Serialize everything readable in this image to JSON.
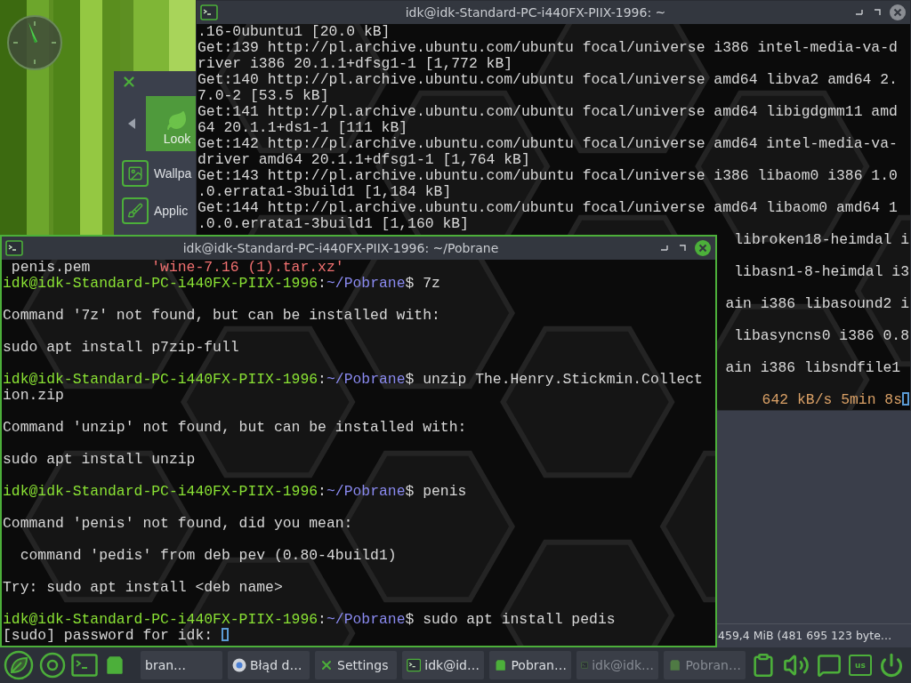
{
  "settings_window": {
    "items": [
      {
        "label": "Look",
        "selected": true
      },
      {
        "label": "Wallpa",
        "selected": false
      },
      {
        "label": "Applic",
        "selected": false
      }
    ]
  },
  "file_window": {
    "status": "459,4 MiB (481 695 123 byte…"
  },
  "terminals": [
    {
      "title": "idk@idk-Standard-PC-i440FX-PIIX-1996: ~",
      "active": false,
      "lines": [
        {
          "kind": "text",
          "segments": [
            {
              "kind": "plain",
              "text": ".16-0ubuntu1 [20.0 kB]"
            }
          ]
        },
        {
          "kind": "text",
          "segments": [
            {
              "kind": "plain",
              "text": "Get:139 http://pl.archive.ubuntu.com/ubuntu focal/universe i386 intel-media-va-d"
            }
          ]
        },
        {
          "kind": "text",
          "segments": [
            {
              "kind": "plain",
              "text": "river i386 20.1.1+dfsg1-1 [1,772 kB]"
            }
          ]
        },
        {
          "kind": "text",
          "segments": [
            {
              "kind": "plain",
              "text": "Get:140 http://pl.archive.ubuntu.com/ubuntu focal/universe amd64 libva2 amd64 2."
            }
          ]
        },
        {
          "kind": "text",
          "segments": [
            {
              "kind": "plain",
              "text": "7.0-2 [53.5 kB]"
            }
          ]
        },
        {
          "kind": "text",
          "segments": [
            {
              "kind": "plain",
              "text": "Get:141 http://pl.archive.ubuntu.com/ubuntu focal/universe amd64 libigdgmm11 amd"
            }
          ]
        },
        {
          "kind": "text",
          "segments": [
            {
              "kind": "plain",
              "text": "64 20.1.1+ds1-1 [111 kB]"
            }
          ]
        },
        {
          "kind": "text",
          "segments": [
            {
              "kind": "plain",
              "text": "Get:142 http://pl.archive.ubuntu.com/ubuntu focal/universe amd64 intel-media-va-"
            }
          ]
        },
        {
          "kind": "text",
          "segments": [
            {
              "kind": "plain",
              "text": "driver amd64 20.1.1+dfsg1-1 [1,764 kB]"
            }
          ]
        },
        {
          "kind": "text",
          "segments": [
            {
              "kind": "plain",
              "text": "Get:143 http://pl.archive.ubuntu.com/ubuntu focal/universe i386 libaom0 i386 1.0"
            }
          ]
        },
        {
          "kind": "text",
          "segments": [
            {
              "kind": "plain",
              "text": ".0.errata1-3build1 [1,184 kB]"
            }
          ]
        },
        {
          "kind": "text",
          "segments": [
            {
              "kind": "plain",
              "text": "Get:144 http://pl.archive.ubuntu.com/ubuntu focal/universe amd64 libaom0 amd64 1"
            }
          ]
        },
        {
          "kind": "text",
          "segments": [
            {
              "kind": "plain",
              "text": ".0.0.errata1-3build1 [1,160 kB]"
            }
          ]
        },
        {
          "kind": "tail",
          "segments": [
            {
              "kind": "plain",
              "text": "libroken18-heimdal i"
            }
          ]
        },
        {
          "kind": "blank"
        },
        {
          "kind": "tail",
          "segments": [
            {
              "kind": "plain",
              "text": "libasn1-8-heimdal i3"
            }
          ]
        },
        {
          "kind": "blank"
        },
        {
          "kind": "tail",
          "segments": [
            {
              "kind": "plain",
              "text": "ain i386 libasound2 i"
            }
          ]
        },
        {
          "kind": "blank"
        },
        {
          "kind": "tail",
          "segments": [
            {
              "kind": "plain",
              "text": "libasyncns0 i386 0.8"
            }
          ]
        },
        {
          "kind": "blank"
        },
        {
          "kind": "tail",
          "segments": [
            {
              "kind": "plain",
              "text": "ain i386 libsndfile1 "
            }
          ]
        },
        {
          "kind": "blank"
        },
        {
          "kind": "tail",
          "segments": [
            {
              "kind": "progress",
              "text": "642 kB/s 5min 8s"
            },
            {
              "kind": "cursor"
            }
          ]
        }
      ]
    },
    {
      "title": "idk@idk-Standard-PC-i440FX-PIIX-1996: ~/Pobrane",
      "active": true,
      "lines": [
        {
          "kind": "text",
          "segments": [
            {
              "kind": "plain",
              "text": " penis.pem       "
            },
            {
              "kind": "red",
              "text": "'wine-7.16 (1).tar.xz'"
            }
          ]
        },
        {
          "kind": "text",
          "segments": [
            {
              "kind": "user",
              "text": "idk@idk-Standard-PC-i440FX-PIIX-1996"
            },
            {
              "kind": "plain",
              "text": ":"
            },
            {
              "kind": "path",
              "text": "~/Pobrane"
            },
            {
              "kind": "plain",
              "text": "$ 7z"
            }
          ]
        },
        {
          "kind": "blank"
        },
        {
          "kind": "text",
          "segments": [
            {
              "kind": "plain",
              "text": "Command '7z' not found, but can be installed with:"
            }
          ]
        },
        {
          "kind": "blank"
        },
        {
          "kind": "text",
          "segments": [
            {
              "kind": "plain",
              "text": "sudo apt install p7zip-full"
            }
          ]
        },
        {
          "kind": "blank"
        },
        {
          "kind": "text",
          "segments": [
            {
              "kind": "user",
              "text": "idk@idk-Standard-PC-i440FX-PIIX-1996"
            },
            {
              "kind": "plain",
              "text": ":"
            },
            {
              "kind": "path",
              "text": "~/Pobrane"
            },
            {
              "kind": "plain",
              "text": "$ unzip The.Henry.Stickmin.Collect"
            }
          ]
        },
        {
          "kind": "text",
          "segments": [
            {
              "kind": "plain",
              "text": "ion.zip"
            }
          ]
        },
        {
          "kind": "blank"
        },
        {
          "kind": "text",
          "segments": [
            {
              "kind": "plain",
              "text": "Command 'unzip' not found, but can be installed with:"
            }
          ]
        },
        {
          "kind": "blank"
        },
        {
          "kind": "text",
          "segments": [
            {
              "kind": "plain",
              "text": "sudo apt install unzip"
            }
          ]
        },
        {
          "kind": "blank"
        },
        {
          "kind": "text",
          "segments": [
            {
              "kind": "user",
              "text": "idk@idk-Standard-PC-i440FX-PIIX-1996"
            },
            {
              "kind": "plain",
              "text": ":"
            },
            {
              "kind": "path",
              "text": "~/Pobrane"
            },
            {
              "kind": "plain",
              "text": "$ penis"
            }
          ]
        },
        {
          "kind": "blank"
        },
        {
          "kind": "text",
          "segments": [
            {
              "kind": "plain",
              "text": "Command 'penis' not found, did you mean:"
            }
          ]
        },
        {
          "kind": "blank"
        },
        {
          "kind": "text",
          "segments": [
            {
              "kind": "plain",
              "text": "  command 'pedis' from deb pev (0.80-4build1)"
            }
          ]
        },
        {
          "kind": "blank"
        },
        {
          "kind": "text",
          "segments": [
            {
              "kind": "plain",
              "text": "Try: sudo apt install <deb name>"
            }
          ]
        },
        {
          "kind": "blank"
        },
        {
          "kind": "text",
          "segments": [
            {
              "kind": "user",
              "text": "idk@idk-Standard-PC-i440FX-PIIX-1996"
            },
            {
              "kind": "plain",
              "text": ":"
            },
            {
              "kind": "path",
              "text": "~/Pobrane"
            },
            {
              "kind": "plain",
              "text": "$ sudo apt install pedis"
            }
          ]
        },
        {
          "kind": "text",
          "segments": [
            {
              "kind": "plain",
              "text": "[sudo] password for idk: "
            },
            {
              "kind": "cursor"
            }
          ]
        }
      ]
    }
  ],
  "taskbar": {
    "tasks": [
      {
        "label": "bran…",
        "kind": "none",
        "dimmed": false
      },
      {
        "label": "Błąd d…",
        "kind": "browser",
        "dimmed": false
      },
      {
        "label": "Settings",
        "kind": "settings",
        "dimmed": false
      },
      {
        "label": "idk@id…",
        "kind": "terminal",
        "dimmed": false
      },
      {
        "label": "Pobran…",
        "kind": "files",
        "dimmed": false
      },
      {
        "label": "idk@idk…",
        "kind": "terminal",
        "dimmed": true
      },
      {
        "label": "Pobran…",
        "kind": "files",
        "dimmed": true
      }
    ],
    "keyboard_layout": "us"
  }
}
